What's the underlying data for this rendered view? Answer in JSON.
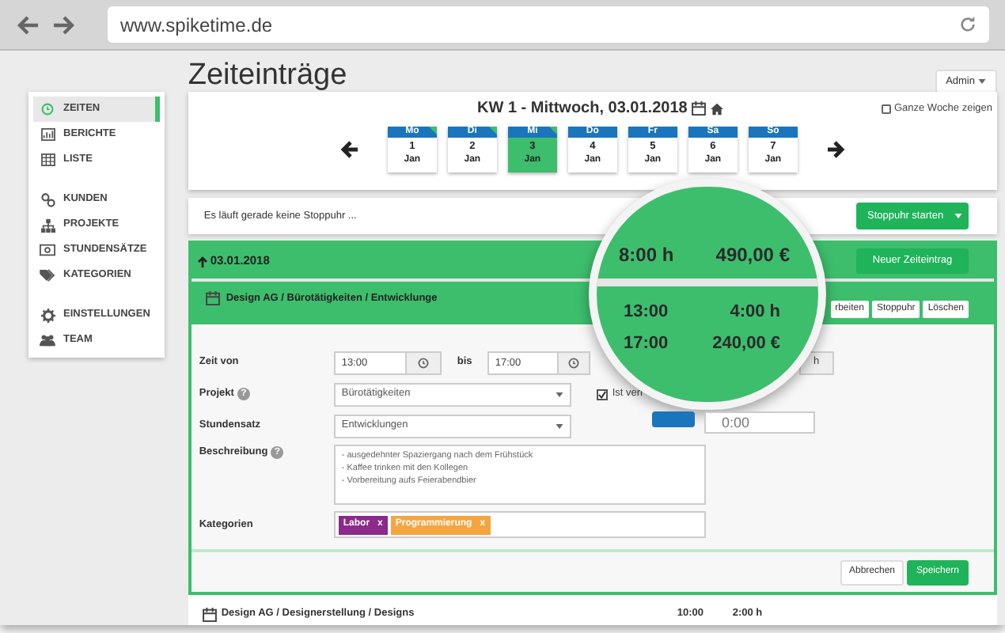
{
  "browser": {
    "url": "www.spiketime.de"
  },
  "page": {
    "title": "Zeiteinträge",
    "user_menu": "Admin"
  },
  "sidebar": {
    "groups": [
      {
        "items": [
          {
            "label": "ZEITEN",
            "kind": "clock",
            "selected": true
          },
          {
            "label": "BERICHTE",
            "kind": "report",
            "selected": false
          },
          {
            "label": "LISTE",
            "kind": "table",
            "selected": false
          }
        ]
      },
      {
        "items": [
          {
            "label": "KUNDEN",
            "kind": "link",
            "selected": false
          },
          {
            "label": "PROJEKTE",
            "kind": "sitemap",
            "selected": false
          },
          {
            "label": "STUNDENSÄTZE",
            "kind": "money",
            "selected": false
          },
          {
            "label": "KATEGORIEN",
            "kind": "tags",
            "selected": false
          }
        ]
      },
      {
        "items": [
          {
            "label": "EINSTELLUNGEN",
            "kind": "gear",
            "selected": false
          },
          {
            "label": "TEAM",
            "kind": "users",
            "selected": false
          }
        ]
      }
    ]
  },
  "week": {
    "title": "KW 1 - Mittwoch, 03.01.2018",
    "show_week": {
      "label": "Ganze Woche zeigen",
      "checked": false
    },
    "days": [
      {
        "weekday": "Mo",
        "day": "1",
        "month": "Jan",
        "selected": false,
        "has_entries": true
      },
      {
        "weekday": "Di",
        "day": "2",
        "month": "Jan",
        "selected": false,
        "has_entries": true
      },
      {
        "weekday": "Mi",
        "day": "3",
        "month": "Jan",
        "selected": true,
        "has_entries": true
      },
      {
        "weekday": "Do",
        "day": "4",
        "month": "Jan",
        "selected": false,
        "has_entries": false
      },
      {
        "weekday": "Fr",
        "day": "5",
        "month": "Jan",
        "selected": false,
        "has_entries": false
      },
      {
        "weekday": "Sa",
        "day": "6",
        "month": "Jan",
        "selected": false,
        "has_entries": false
      },
      {
        "weekday": "So",
        "day": "7",
        "month": "Jan",
        "selected": false,
        "has_entries": false
      }
    ]
  },
  "stopwatch": {
    "status": "Es läuft gerade keine Stoppuhr ...",
    "start_button": "Stoppuhr starten"
  },
  "day_group": {
    "date": "03.01.2018",
    "new_button": "Neuer Zeiteintrag",
    "entry": {
      "title": "Design AG / Bürotätigkeiten / Entwicklunge",
      "buttons": [
        "rbeiten",
        "Stoppuhr",
        "Löschen"
      ]
    }
  },
  "form": {
    "time_from_label": "Zeit von",
    "time_from": "13:00",
    "to_label": "bis",
    "time_to": "17:00",
    "duration_unit": "h",
    "project_label": "Projekt",
    "project_help": "?",
    "project": "Bürotätigkeiten",
    "billed": {
      "label": "Ist verr",
      "checked": true
    },
    "timer_value": "0:00",
    "rate_label": "Stundensatz",
    "rate": "Entwicklungen",
    "description_label": "Beschreibung",
    "description_help": "?",
    "description": "- ausgedehnter Spaziergang nach dem Frühstück\n- Kaffee trinken mit den Kollegen\n- Vorbereitung aufs Feierabendbier",
    "categories_label": "Kategorien",
    "categories": [
      {
        "label": "Labor",
        "remove": "x",
        "color": "#8b2a8b"
      },
      {
        "label": "Programmierung",
        "remove": "x",
        "color": "#f5a540"
      }
    ],
    "cancel": "Abbrechen",
    "save": "Speichern"
  },
  "next_entry": {
    "title": "Design AG / Designerstellung / Designs",
    "start": "10:00",
    "duration": "2:00 h"
  },
  "magnifier": {
    "day_total": "8:00 h",
    "day_amount": "490,00 €",
    "start": "13:00",
    "end": "17:00",
    "duration": "4:00 h",
    "amount": "240,00 €"
  }
}
